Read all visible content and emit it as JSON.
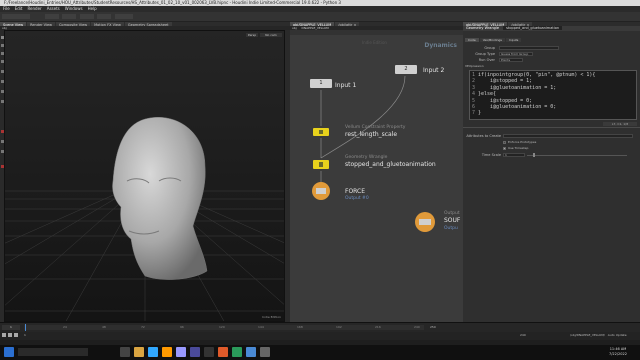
{
  "window": {
    "title": "F:/Freelance/Houdini_Entries/HOU_Attributes/StudentResources/HS_Attributes_01_02_10_v01_002063_LVB.hipnc - Houdini Indie Limited-Commercial 19.0.622 - Python 3"
  },
  "menu": [
    "File",
    "Edit",
    "Render",
    "Assets",
    "Windows",
    "Help"
  ],
  "viewport": {
    "tabs": [
      "Scene View",
      "Render View",
      "Composite View",
      "Motion FX View",
      "Geometry Spreadsheet"
    ],
    "toolbar_path": "obj",
    "mode_label": "Persp",
    "camera_label": "No cam",
    "corner_label": "Indie Edition"
  },
  "network": {
    "tabs": [
      "obj/DNAPPLE_VELLUM",
      "/obj/attr_v"
    ],
    "path": "obj",
    "node_path": "DNAPPLE_VELLUM",
    "context_label": "Dynamics",
    "watermark": "Indie Edition",
    "nodes": [
      {
        "id": "input1",
        "number": "1",
        "label": "Input 1"
      },
      {
        "id": "input2",
        "number": "2",
        "label": "Input 2"
      },
      {
        "id": "constraint",
        "type_label": "Vellum Constraint Property",
        "label": "rest_length_scale"
      },
      {
        "id": "wrangle",
        "type_label": "Geometry Wrangle",
        "label": "stopped_and_gluetoanimation"
      },
      {
        "id": "force",
        "label": "FORCE",
        "sub": "Output #0"
      },
      {
        "id": "source",
        "label": "SOUF",
        "type_label": "Output",
        "sub": "Outpu"
      }
    ]
  },
  "parameters": {
    "tabs": [
      "obj/DNAPPLE_VELLUM",
      "/obj/attr_v"
    ],
    "node_type": "Geometry Wrangle",
    "node_name": "stopped_and_gluetoanimation",
    "sub_tabs": [
      "Code",
      "Vex/Bindings",
      "Inputs"
    ],
    "group_label": "Group",
    "group_type_label": "Group Type",
    "group_type_value": "Guess from Group",
    "run_over_label": "Run Over",
    "run_over_value": "Points",
    "vexpression_label": "VEXpression",
    "code_lines": [
      {
        "n": "1",
        "text": "if(inpointgroup(0, \"pin\", @ptnum) < 1){"
      },
      {
        "n": "2",
        "text": "    i@stopped = 1;"
      },
      {
        "n": "3",
        "text": "    i@gluetoanimation = 1;"
      },
      {
        "n": "4",
        "text": "}else{"
      },
      {
        "n": "5",
        "text": "    i@stopped = 0;"
      },
      {
        "n": "6",
        "text": "    i@gluetoanimation = 0;"
      },
      {
        "n": "7",
        "text": "}"
      }
    ],
    "code_status": "L7, C1, 1/8",
    "attributes_to_create_label": "Attributes to Create",
    "enforce_prototypes_label": "Enforce Prototypes",
    "use_timestep_label": "Use Timestep",
    "time_scale_label": "Time Scale",
    "time_scale_value": "1"
  },
  "timeline": {
    "frame": "1",
    "start": "1",
    "end": "240",
    "current_time_label": "250",
    "tick_labels": [
      "24",
      "48",
      "72",
      "96",
      "120",
      "144",
      "168",
      "192",
      "216",
      "240"
    ]
  },
  "status_bar": {
    "path": "/obj/DNAPPLE_VELLUM/",
    "mode": "Auto Update"
  },
  "taskbar": {
    "time": "11:46 AM",
    "date": "7/22/2022"
  }
}
